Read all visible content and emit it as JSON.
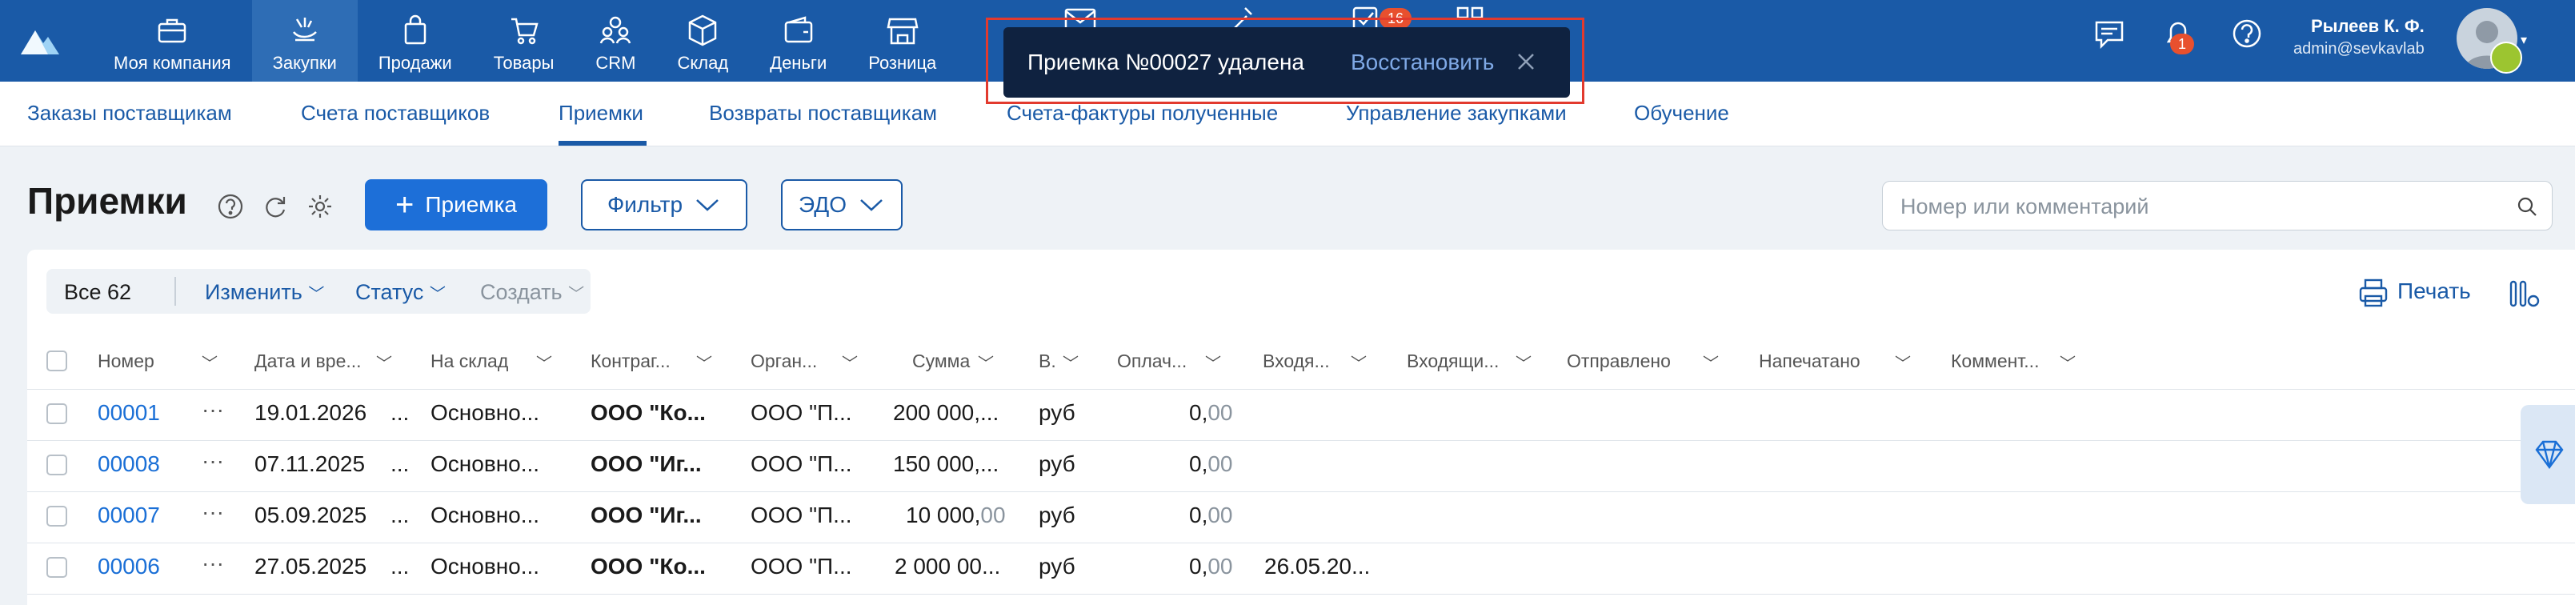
{
  "nav": {
    "items": [
      {
        "label": "Моя компания",
        "icon": "briefcase-icon"
      },
      {
        "label": "Закупки",
        "icon": "basket-hand-icon"
      },
      {
        "label": "Продажи",
        "icon": "shopping-bag-icon"
      },
      {
        "label": "Товары",
        "icon": "cart-icon"
      },
      {
        "label": "CRM",
        "icon": "people-icon"
      },
      {
        "label": "Склад",
        "icon": "box-icon"
      },
      {
        "label": "Деньги",
        "icon": "wallet-icon"
      },
      {
        "label": "Розница",
        "icon": "store-icon"
      }
    ],
    "active_index": 1,
    "notif_badge": "16",
    "bell_badge": "1"
  },
  "user": {
    "name": "Рылеев К. Ф.",
    "email": "admin@sevkavlab"
  },
  "subnav": [
    "Заказы поставщикам",
    "Счета поставщиков",
    "Приемки",
    "Возвраты поставщикам",
    "Счета-фактуры полученные",
    "Управление закупками",
    "Обучение"
  ],
  "toast": {
    "message": "Приемка №00027 удалена",
    "action": "Восстановить"
  },
  "page": {
    "title": "Приемки",
    "add_button": "Приемка",
    "filter_button": "Фильтр",
    "edo_button": "ЭДО",
    "search_placeholder": "Номер или комментарий"
  },
  "toolbar": {
    "all": "Все 62",
    "edit": "Изменить",
    "status": "Статус",
    "create": "Создать",
    "print": "Печать"
  },
  "columns": [
    "Номер",
    "Дата и вре...",
    "На склад",
    "Контраг...",
    "Орган...",
    "Сумма",
    "В.",
    "Оплач...",
    "Входя...",
    "Входящи...",
    "Отправлено",
    "Напечатано",
    "Коммент..."
  ],
  "rows": [
    {
      "number": "00001",
      "date": "19.01.2026",
      "dots": "...",
      "warehouse": "Основно...",
      "contractor": "ООО \"Ко...",
      "org": "ООО \"П...",
      "sum_main": "200 000,",
      "sum_dec": "...",
      "cur": "руб",
      "paid_int": "0,",
      "paid_dec": "00",
      "incoming": ""
    },
    {
      "number": "00008",
      "date": "07.11.2025",
      "dots": "...",
      "warehouse": "Основно...",
      "contractor": "ООО \"Иг...",
      "org": "ООО \"П...",
      "sum_main": "150 000,",
      "sum_dec": "...",
      "cur": "руб",
      "paid_int": "0,",
      "paid_dec": "00",
      "incoming": ""
    },
    {
      "number": "00007",
      "date": "05.09.2025",
      "dots": "...",
      "warehouse": "Основно...",
      "contractor": "ООО \"Иг...",
      "org": "ООО \"П...",
      "sum_main": "10 000,",
      "sum_dec": "00",
      "cur": "руб",
      "paid_int": "0,",
      "paid_dec": "00",
      "incoming": ""
    },
    {
      "number": "00006",
      "date": "27.05.2025",
      "dots": "...",
      "warehouse": "Основно...",
      "contractor": "ООО \"Ко...",
      "org": "ООО \"П...",
      "sum_main": "2 000 00",
      "sum_dec": "...",
      "cur": "руб",
      "paid_int": "0,",
      "paid_dec": "00",
      "incoming": "26.05.20..."
    }
  ],
  "colors": {
    "brand": "#1a5aa7",
    "accent": "#1d6fd8",
    "toast_bg": "#0f2240",
    "highlight": "#e23a2e"
  }
}
